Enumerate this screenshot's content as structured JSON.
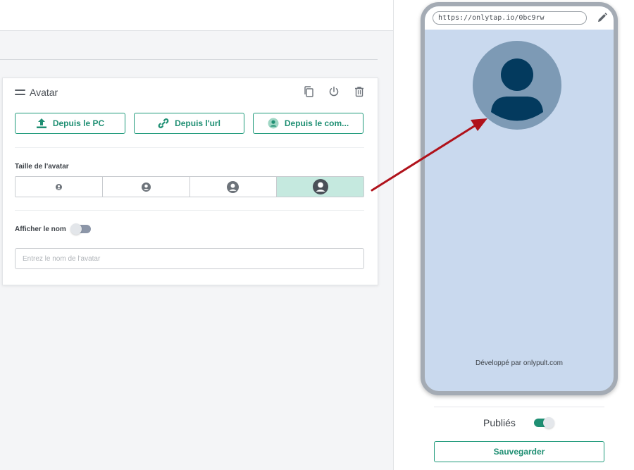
{
  "editor": {
    "block_title": "Avatar",
    "source_buttons": [
      {
        "label": "Depuis le PC",
        "icon": "upload-icon"
      },
      {
        "label": "Depuis l'url",
        "icon": "link-icon"
      },
      {
        "label": "Depuis le com...",
        "icon": "user-circle-icon"
      }
    ],
    "size_label": "Taille de l'avatar",
    "size_options_count": 4,
    "size_selected_index": 3,
    "show_name_label": "Afficher le nom",
    "show_name_enabled": false,
    "name_placeholder": "Entrez le nom de l'avatar",
    "actions": [
      "copy-icon",
      "power-icon",
      "trash-icon"
    ]
  },
  "preview": {
    "url": "https://onlytap.io/0bc9rw",
    "footer": "Développé par onlypult.com",
    "background_color": "#c9d9ee"
  },
  "publish": {
    "label": "Publiés",
    "enabled": true,
    "save_label": "Sauvegarder"
  },
  "colors": {
    "accent": "#1f8f73",
    "selected_segment": "#c5e9df",
    "arrow": "#b0121b"
  }
}
